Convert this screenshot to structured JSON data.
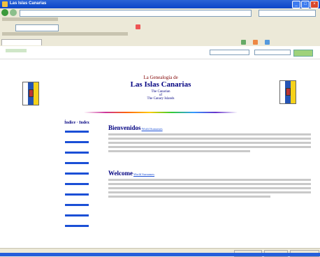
{
  "window": {
    "title": "Las Islas Canarias"
  },
  "menu": [],
  "google": {},
  "favorites": [],
  "tab": {
    "label": ""
  },
  "inner_bar": {},
  "page": {
    "header": {
      "line1": "La Genealogía de",
      "line2": "Las Islas Canarias",
      "line3": "The Canarian",
      "line4": "of",
      "line5": "The Canary Islands"
    },
    "sidebar": {
      "header": "Índice · Index",
      "links": []
    },
    "intro": {
      "lead_word": "Bienvenidos",
      "link": "World Surnames"
    },
    "welcome": {
      "lead_word": "Welcome",
      "link": "World Surnames"
    }
  },
  "status": {},
  "colors": {
    "accent": "#000080",
    "link": "#1b4fd6",
    "flag_blue": "#2554b4",
    "flag_yellow": "#f6d21a"
  }
}
